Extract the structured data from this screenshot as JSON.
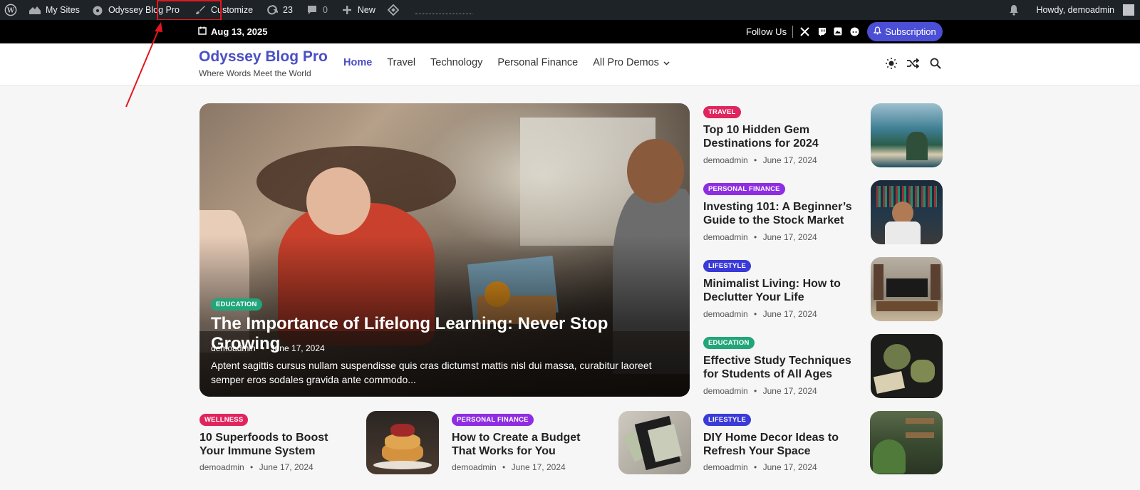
{
  "adminbar": {
    "my_sites": "My Sites",
    "site_name": "Odyssey Blog Pro",
    "customize": "Customize",
    "updates_count": "23",
    "comments_count": "0",
    "new_label": "New",
    "howdy": "Howdy, demoadmin"
  },
  "topbar": {
    "date": "Aug 13, 2025",
    "follow_label": "Follow Us",
    "subscribe_label": "Subscription"
  },
  "header": {
    "site_title": "Odyssey Blog Pro",
    "tagline": "Where Words Meet the World",
    "nav": [
      "Home",
      "Travel",
      "Technology",
      "Personal Finance",
      "All Pro Demos"
    ]
  },
  "hero": {
    "category": "EDUCATION",
    "title": "The Importance of Lifelong Learning: Never Stop Growing",
    "author": "demoadmin",
    "date": "June 17, 2024",
    "excerpt": "Aptent sagittis cursus nullam suspendisse quis cras dictumst mattis nisl dui massa, curabitur laoreet semper eros sodales gravida ante commodo..."
  },
  "side_posts": [
    {
      "category": "TRAVEL",
      "title": "Top 10 Hidden Gem Destinations for 2024",
      "author": "demoadmin",
      "date": "June 17, 2024"
    },
    {
      "category": "PERSONAL FINANCE",
      "title": "Investing 101: A Beginner’s Guide to the Stock Market",
      "author": "demoadmin",
      "date": "June 17, 2024"
    },
    {
      "category": "LIFESTYLE",
      "title": "Minimalist Living: How to Declutter Your Life",
      "author": "demoadmin",
      "date": "June 17, 2024"
    },
    {
      "category": "EDUCATION",
      "title": "Effective Study Techniques for Students of All Ages",
      "author": "demoadmin",
      "date": "June 17, 2024"
    }
  ],
  "bottom_posts": [
    {
      "category": "WELLNESS",
      "title": "10 Superfoods to Boost Your Immune System",
      "author": "demoadmin",
      "date": "June 17, 2024"
    },
    {
      "category": "PERSONAL FINANCE",
      "title": "How to Create a Budget That Works for You",
      "author": "demoadmin",
      "date": "June 17, 2024"
    },
    {
      "category": "LIFESTYLE",
      "title": "DIY Home Decor Ideas to Refresh Your Space",
      "author": "demoadmin",
      "date": "June 17, 2024"
    }
  ],
  "meta_separator": "•",
  "colors": {
    "brand": "#4b4fc4",
    "subscribe": "#4b4fd6",
    "annotation": "#e3171f"
  }
}
